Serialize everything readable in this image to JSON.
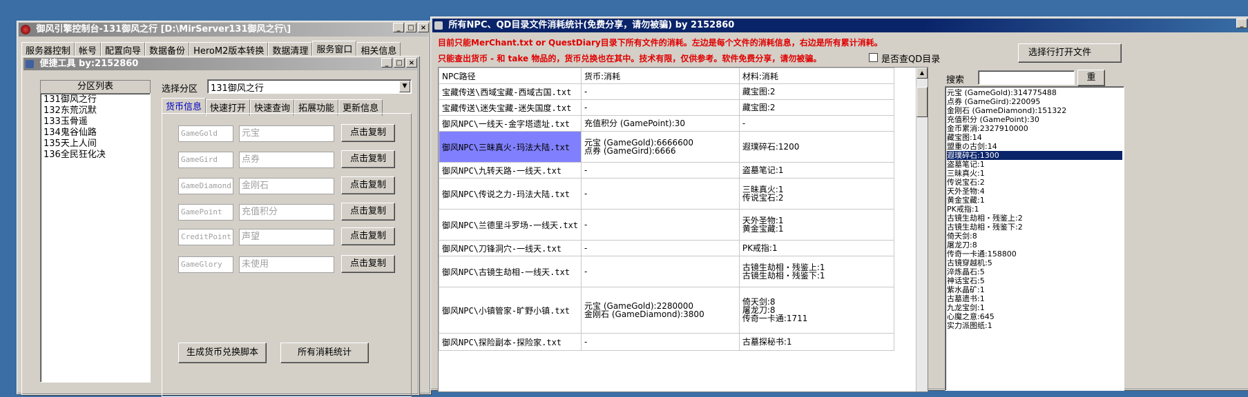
{
  "left_window": {
    "title": "御风引擎控制台-131御风之行 [D:\\MirServer131御风之行\\]",
    "menu_tabs": [
      "服务器控制",
      "帐号",
      "配置向导",
      "数据备份",
      "HeroM2版本转换",
      "数据清理",
      "服务窗口",
      "相关信息"
    ],
    "sub_window": {
      "title": "便捷工具  by:2152860",
      "partition_header": "分区列表",
      "partitions": [
        "131御风之行",
        "132东荒沉默",
        "133玉骨遥",
        "134鬼谷仙路",
        "135天上人间",
        "136全民狂化决"
      ],
      "select_label": "选择分区",
      "selected_partition": "131御风之行",
      "tabs": [
        "货币信息",
        "快速打开",
        "快速查询",
        "拓展功能",
        "更新信息"
      ],
      "currency_rows": [
        {
          "code": "GameGold",
          "name": "元宝",
          "button": "点击复制"
        },
        {
          "code": "GameGird",
          "name": "点券",
          "button": "点击复制"
        },
        {
          "code": "GameDiamond",
          "name": "金刚石",
          "button": "点击复制"
        },
        {
          "code": "GamePoint",
          "name": "充值积分",
          "button": "点击复制"
        },
        {
          "code": "CreditPoint",
          "name": "声望",
          "button": "点击复制"
        },
        {
          "code": "GameGlory",
          "name": "未使用",
          "button": "点击复制"
        }
      ],
      "generate_button": "生成货币兑换脚本",
      "stats_button": "所有消耗统计"
    }
  },
  "right_window": {
    "title": "所有NPC、QD目录文件消耗统计(免费分享，请勿被骗)     by 2152860",
    "notice_line1": "目前只能MerChant.txt or QuestDiary目录下所有文件的消耗。左边是每个文件的消耗信息，右边是所有累计消耗。",
    "notice_line2": "只能查出货币 - 和 take 物品的，货币兑换也在其中。技术有限，仅供参考。软件免费分享，请勿被骗。",
    "checkbox_label": "是否查QD目录",
    "open_button": "选择行打开文件",
    "columns": [
      "NPC路径",
      "货币:消耗",
      "材料:消耗"
    ],
    "rows": [
      {
        "path": "宝藏传送\\西域宝藏-西域古国.txt",
        "currency": [
          "-"
        ],
        "material": [
          "藏宝图:2"
        ]
      },
      {
        "path": "宝藏传送\\迷失宝藏-迷失国度.txt",
        "currency": [
          "-"
        ],
        "material": [
          "藏宝图:2"
        ]
      },
      {
        "path": "御风NPC\\一线天-金字塔遗址.txt",
        "currency": [
          "充值积分 (GamePoint):30"
        ],
        "material": [
          "-"
        ]
      },
      {
        "path": "御风NPC\\三昧真火-玛法大陆.txt",
        "currency": [
          "元宝 (GameGold):6666600",
          "点券 (GameGird):6666"
        ],
        "material": [
          "遐璞碎石:1200"
        ]
      },
      {
        "path": "御风NPC\\九转天路-一线天.txt",
        "currency": [
          "-"
        ],
        "material": [
          "盗墓笔记:1"
        ]
      },
      {
        "path": "御风NPC\\传说之力-玛法大陆.txt",
        "currency": [
          "-"
        ],
        "material": [
          "三昧真火:1",
          "传说宝石:2"
        ]
      },
      {
        "path": "御风NPC\\兰德里斗罗场-一线天.txt",
        "currency": [
          "-"
        ],
        "material": [
          "天外圣物:1",
          "黄金宝藏:1"
        ]
      },
      {
        "path": "御风NPC\\刀锋洞穴-一线天.txt",
        "currency": [
          "-"
        ],
        "material": [
          "PK戒指:1"
        ]
      },
      {
        "path": "御风NPC\\古镜生劫相-一线天.txt",
        "currency": [
          "-"
        ],
        "material": [
          "古镜生劫相・残鉴上:1",
          "古镜生劫相・残鉴下:1"
        ]
      },
      {
        "path": "御风NPC\\小镇管家-旷野小镇.txt",
        "currency": [
          "元宝 (GameGold):2280000",
          "金刚石 (GameDiamond):3800"
        ],
        "material": [
          "倚天剑:8",
          "屠龙刀:8",
          "传奇一卡通:1711"
        ]
      },
      {
        "path": "御风NPC\\探险副本-探险家.txt",
        "currency": [
          "-"
        ],
        "material": [
          "古墓探秘书:1"
        ]
      }
    ],
    "search_label": "搜索",
    "search_button": "重",
    "totals": [
      "元宝 (GameGold):314775488",
      "点券 (GameGird):220095",
      "金刚石 (GameDiamond):151322",
      "充值积分 (GamePoint):30",
      "金币累消:2327910000",
      "藏宝图:14",
      "盟重の古剑:14",
      "遐璞碎石:1300",
      "盗墓笔记:1",
      "三昧真火:1",
      "传说宝石:2",
      "天外圣物:4",
      "黄金宝藏:1",
      "PK戒指:1",
      "古镜生劫相・残鉴上:2",
      "古镜生劫相・残鉴下:2",
      "倚天剑:8",
      "屠龙刀:8",
      "传奇一卡通:158800",
      "古镜穿越机:5",
      "淬炼晶石:5",
      "神话宝石:5",
      "紫水晶矿:1",
      "古墓遗书:1",
      "九龙宝剑:1",
      "心魔之意:645",
      "实力派图纸:1"
    ],
    "selected_total_index": 7
  }
}
